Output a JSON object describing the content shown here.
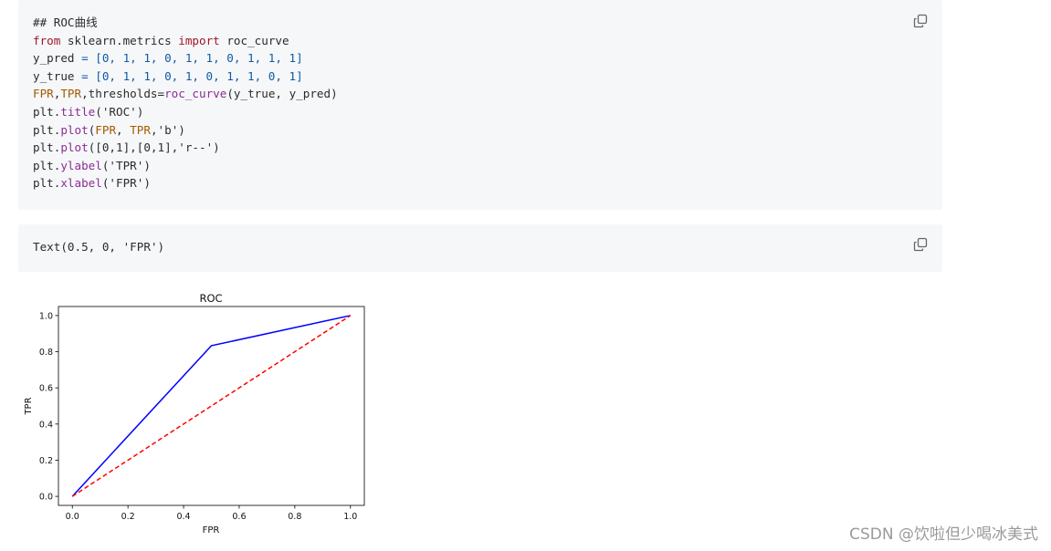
{
  "code_cell": {
    "lines": [
      [
        {
          "t": "## ROC曲线",
          "c": "s"
        }
      ],
      [
        {
          "t": "from",
          "c": "k"
        },
        {
          "t": " sklearn.metrics ",
          "c": "s"
        },
        {
          "t": "import",
          "c": "k"
        },
        {
          "t": " roc_curve",
          "c": "s"
        }
      ],
      [
        {
          "t": "y_pred ",
          "c": "s"
        },
        {
          "t": "= [",
          "c": "m"
        },
        {
          "t": "0, 1, 1, 0, 1, 1, 0, 1, 1, 1",
          "c": "m"
        },
        {
          "t": "]",
          "c": "m"
        }
      ],
      [
        {
          "t": "y_true ",
          "c": "s"
        },
        {
          "t": "= [",
          "c": "m"
        },
        {
          "t": "0, 1, 1, 0, 1, 0, 1, 1, 0, 1",
          "c": "m"
        },
        {
          "t": "]",
          "c": "m"
        }
      ],
      [
        {
          "t": "FPR",
          "c": "v"
        },
        {
          "t": ",",
          "c": "s"
        },
        {
          "t": "TPR",
          "c": "v"
        },
        {
          "t": ",thresholds=",
          "c": "s"
        },
        {
          "t": "roc_curve",
          "c": "f"
        },
        {
          "t": "(y_true, y_pred)",
          "c": "s"
        }
      ],
      [
        {
          "t": "plt.",
          "c": "s"
        },
        {
          "t": "title",
          "c": "f"
        },
        {
          "t": "('ROC')",
          "c": "s"
        }
      ],
      [
        {
          "t": "plt.",
          "c": "s"
        },
        {
          "t": "plot",
          "c": "f"
        },
        {
          "t": "(",
          "c": "s"
        },
        {
          "t": "FPR",
          "c": "v"
        },
        {
          "t": ", ",
          "c": "s"
        },
        {
          "t": "TPR",
          "c": "v"
        },
        {
          "t": ",'b')",
          "c": "s"
        }
      ],
      [
        {
          "t": "plt.",
          "c": "s"
        },
        {
          "t": "plot",
          "c": "f"
        },
        {
          "t": "([0,1],[0,1],'r--')",
          "c": "s"
        }
      ],
      [
        {
          "t": "plt.",
          "c": "s"
        },
        {
          "t": "ylabel",
          "c": "f"
        },
        {
          "t": "('TPR')",
          "c": "s"
        }
      ],
      [
        {
          "t": "plt.",
          "c": "s"
        },
        {
          "t": "xlabel",
          "c": "f"
        },
        {
          "t": "('FPR')",
          "c": "s"
        }
      ]
    ],
    "copy_icon": "copy-icon"
  },
  "output_cell": {
    "text": "Text(0.5, 0, 'FPR')",
    "copy_icon": "copy-icon"
  },
  "chart_data": {
    "type": "line",
    "title": "ROC",
    "xlabel": "FPR",
    "ylabel": "TPR",
    "xlim": [
      -0.05,
      1.05
    ],
    "ylim": [
      -0.05,
      1.05
    ],
    "xticks": [
      "0.0",
      "0.2",
      "0.4",
      "0.6",
      "0.8",
      "1.0"
    ],
    "yticks": [
      "0.0",
      "0.2",
      "0.4",
      "0.6",
      "0.8",
      "1.0"
    ],
    "grid": false,
    "series": [
      {
        "x": [
          0,
          0.5,
          1
        ],
        "y": [
          0,
          0.8333,
          1
        ],
        "color": "#0000ff",
        "style": "solid"
      },
      {
        "x": [
          0,
          1
        ],
        "y": [
          0,
          1
        ],
        "color": "#ff0000",
        "style": "dashed"
      }
    ]
  },
  "watermark": "CSDN @饮啦但少喝冰美式"
}
